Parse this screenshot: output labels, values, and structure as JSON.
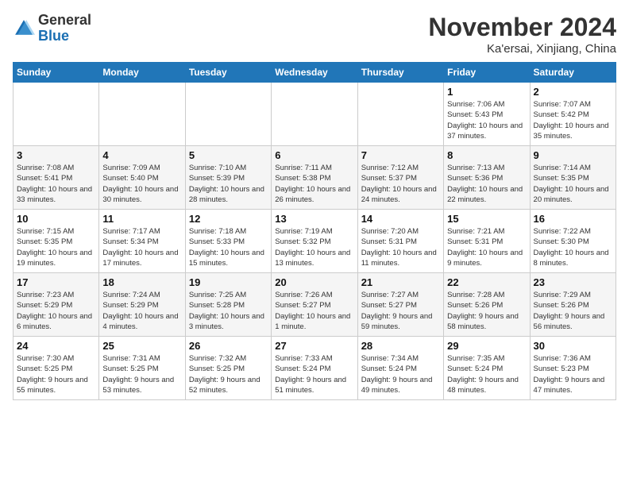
{
  "header": {
    "logo_general": "General",
    "logo_blue": "Blue",
    "month_title": "November 2024",
    "location": "Ka'ersai, Xinjiang, China"
  },
  "weekdays": [
    "Sunday",
    "Monday",
    "Tuesday",
    "Wednesday",
    "Thursday",
    "Friday",
    "Saturday"
  ],
  "weeks": [
    [
      {
        "day": "",
        "info": ""
      },
      {
        "day": "",
        "info": ""
      },
      {
        "day": "",
        "info": ""
      },
      {
        "day": "",
        "info": ""
      },
      {
        "day": "",
        "info": ""
      },
      {
        "day": "1",
        "info": "Sunrise: 7:06 AM\nSunset: 5:43 PM\nDaylight: 10 hours and 37 minutes."
      },
      {
        "day": "2",
        "info": "Sunrise: 7:07 AM\nSunset: 5:42 PM\nDaylight: 10 hours and 35 minutes."
      }
    ],
    [
      {
        "day": "3",
        "info": "Sunrise: 7:08 AM\nSunset: 5:41 PM\nDaylight: 10 hours and 33 minutes."
      },
      {
        "day": "4",
        "info": "Sunrise: 7:09 AM\nSunset: 5:40 PM\nDaylight: 10 hours and 30 minutes."
      },
      {
        "day": "5",
        "info": "Sunrise: 7:10 AM\nSunset: 5:39 PM\nDaylight: 10 hours and 28 minutes."
      },
      {
        "day": "6",
        "info": "Sunrise: 7:11 AM\nSunset: 5:38 PM\nDaylight: 10 hours and 26 minutes."
      },
      {
        "day": "7",
        "info": "Sunrise: 7:12 AM\nSunset: 5:37 PM\nDaylight: 10 hours and 24 minutes."
      },
      {
        "day": "8",
        "info": "Sunrise: 7:13 AM\nSunset: 5:36 PM\nDaylight: 10 hours and 22 minutes."
      },
      {
        "day": "9",
        "info": "Sunrise: 7:14 AM\nSunset: 5:35 PM\nDaylight: 10 hours and 20 minutes."
      }
    ],
    [
      {
        "day": "10",
        "info": "Sunrise: 7:15 AM\nSunset: 5:35 PM\nDaylight: 10 hours and 19 minutes."
      },
      {
        "day": "11",
        "info": "Sunrise: 7:17 AM\nSunset: 5:34 PM\nDaylight: 10 hours and 17 minutes."
      },
      {
        "day": "12",
        "info": "Sunrise: 7:18 AM\nSunset: 5:33 PM\nDaylight: 10 hours and 15 minutes."
      },
      {
        "day": "13",
        "info": "Sunrise: 7:19 AM\nSunset: 5:32 PM\nDaylight: 10 hours and 13 minutes."
      },
      {
        "day": "14",
        "info": "Sunrise: 7:20 AM\nSunset: 5:31 PM\nDaylight: 10 hours and 11 minutes."
      },
      {
        "day": "15",
        "info": "Sunrise: 7:21 AM\nSunset: 5:31 PM\nDaylight: 10 hours and 9 minutes."
      },
      {
        "day": "16",
        "info": "Sunrise: 7:22 AM\nSunset: 5:30 PM\nDaylight: 10 hours and 8 minutes."
      }
    ],
    [
      {
        "day": "17",
        "info": "Sunrise: 7:23 AM\nSunset: 5:29 PM\nDaylight: 10 hours and 6 minutes."
      },
      {
        "day": "18",
        "info": "Sunrise: 7:24 AM\nSunset: 5:29 PM\nDaylight: 10 hours and 4 minutes."
      },
      {
        "day": "19",
        "info": "Sunrise: 7:25 AM\nSunset: 5:28 PM\nDaylight: 10 hours and 3 minutes."
      },
      {
        "day": "20",
        "info": "Sunrise: 7:26 AM\nSunset: 5:27 PM\nDaylight: 10 hours and 1 minute."
      },
      {
        "day": "21",
        "info": "Sunrise: 7:27 AM\nSunset: 5:27 PM\nDaylight: 9 hours and 59 minutes."
      },
      {
        "day": "22",
        "info": "Sunrise: 7:28 AM\nSunset: 5:26 PM\nDaylight: 9 hours and 58 minutes."
      },
      {
        "day": "23",
        "info": "Sunrise: 7:29 AM\nSunset: 5:26 PM\nDaylight: 9 hours and 56 minutes."
      }
    ],
    [
      {
        "day": "24",
        "info": "Sunrise: 7:30 AM\nSunset: 5:25 PM\nDaylight: 9 hours and 55 minutes."
      },
      {
        "day": "25",
        "info": "Sunrise: 7:31 AM\nSunset: 5:25 PM\nDaylight: 9 hours and 53 minutes."
      },
      {
        "day": "26",
        "info": "Sunrise: 7:32 AM\nSunset: 5:25 PM\nDaylight: 9 hours and 52 minutes."
      },
      {
        "day": "27",
        "info": "Sunrise: 7:33 AM\nSunset: 5:24 PM\nDaylight: 9 hours and 51 minutes."
      },
      {
        "day": "28",
        "info": "Sunrise: 7:34 AM\nSunset: 5:24 PM\nDaylight: 9 hours and 49 minutes."
      },
      {
        "day": "29",
        "info": "Sunrise: 7:35 AM\nSunset: 5:24 PM\nDaylight: 9 hours and 48 minutes."
      },
      {
        "day": "30",
        "info": "Sunrise: 7:36 AM\nSunset: 5:23 PM\nDaylight: 9 hours and 47 minutes."
      }
    ]
  ]
}
